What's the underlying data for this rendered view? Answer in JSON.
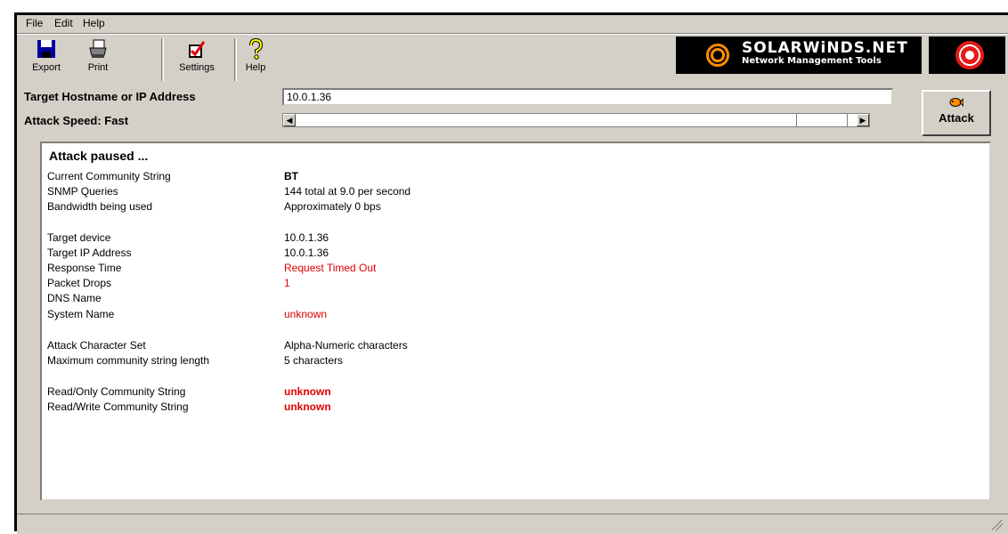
{
  "menu": [
    "File",
    "Edit",
    "Help"
  ],
  "toolbar": {
    "export_label": "Export",
    "print_label": "Print",
    "settings_label": "Settings",
    "help_label": "Help"
  },
  "logo": {
    "name": "SOLARWiNDS.NET",
    "tagline": "Network Management Tools"
  },
  "target": {
    "label": "Target Hostname or IP Address",
    "value": "10.0.1.36"
  },
  "speed": {
    "label": "Attack Speed: Fast"
  },
  "attack_button": "Attack",
  "status": {
    "title": "Attack paused ...",
    "rows": [
      {
        "label": "Current Community String",
        "value": "BT"
      },
      {
        "label": "SNMP Queries",
        "value": "144 total at 9.0 per second"
      },
      {
        "label": "Bandwidth being used",
        "value": "Approximately 0 bps"
      },
      {
        "label": "Target device",
        "value": "10.0.1.36"
      },
      {
        "label": "Target IP Address",
        "value": "10.0.1.36"
      },
      {
        "label": "Response Time",
        "value": "Request Timed Out"
      },
      {
        "label": "Packet Drops",
        "value": "1"
      },
      {
        "label": "DNS Name",
        "value": ""
      },
      {
        "label": "System Name",
        "value": "unknown"
      },
      {
        "label": "Attack Character Set",
        "value": "Alpha-Numeric characters"
      },
      {
        "label": "Maximum community string length",
        "value": "5 characters"
      },
      {
        "label": "Read/Only Community String",
        "value": "unknown"
      },
      {
        "label": "Read/Write Community String",
        "value": "unknown"
      }
    ]
  },
  "colors": {
    "window_bg": "#d4d0c8",
    "alert": "#e00000",
    "logo_bg": "#000000"
  }
}
